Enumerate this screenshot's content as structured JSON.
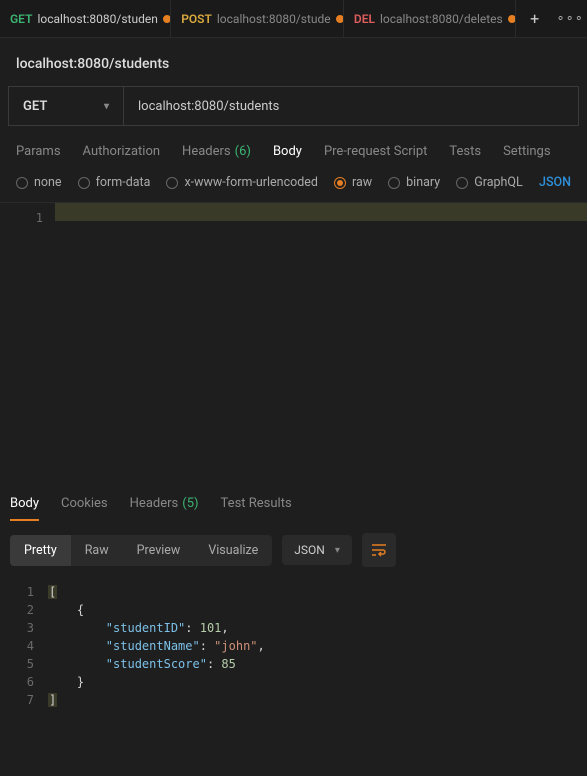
{
  "topTabs": [
    {
      "method": "GET",
      "methodClass": "method-get",
      "label": "localhost:8080/studen",
      "dirty": true,
      "active": true
    },
    {
      "method": "POST",
      "methodClass": "method-post",
      "label": "localhost:8080/stude",
      "dirty": true,
      "active": false
    },
    {
      "method": "DEL",
      "methodClass": "method-del",
      "label": "localhost:8080/deletes",
      "dirty": true,
      "active": false
    }
  ],
  "title": "localhost:8080/students",
  "request": {
    "method": "GET",
    "url": "localhost:8080/students"
  },
  "reqTabs": {
    "params": "Params",
    "authorization": "Authorization",
    "headers": "Headers",
    "headersCount": "(6)",
    "body": "Body",
    "prerequest": "Pre-request Script",
    "tests": "Tests",
    "settings": "Settings"
  },
  "bodyTypes": {
    "none": "none",
    "formdata": "form-data",
    "urlencoded": "x-www-form-urlencoded",
    "raw": "raw",
    "binary": "binary",
    "graphql": "GraphQL",
    "json": "JSON"
  },
  "editor": {
    "line1": "1"
  },
  "respTabs": {
    "body": "Body",
    "cookies": "Cookies",
    "headers": "Headers",
    "headersCount": "(5)",
    "testResults": "Test Results"
  },
  "viewBtns": {
    "pretty": "Pretty",
    "raw": "Raw",
    "preview": "Preview",
    "visualize": "Visualize"
  },
  "format": "JSON",
  "response": {
    "lines": [
      "1",
      "2",
      "3",
      "4",
      "5",
      "6",
      "7"
    ],
    "keys": {
      "id": "\"studentID\"",
      "name": "\"studentName\"",
      "score": "\"studentScore\""
    },
    "vals": {
      "id": "101",
      "name": "\"john\"",
      "score": "85"
    }
  }
}
